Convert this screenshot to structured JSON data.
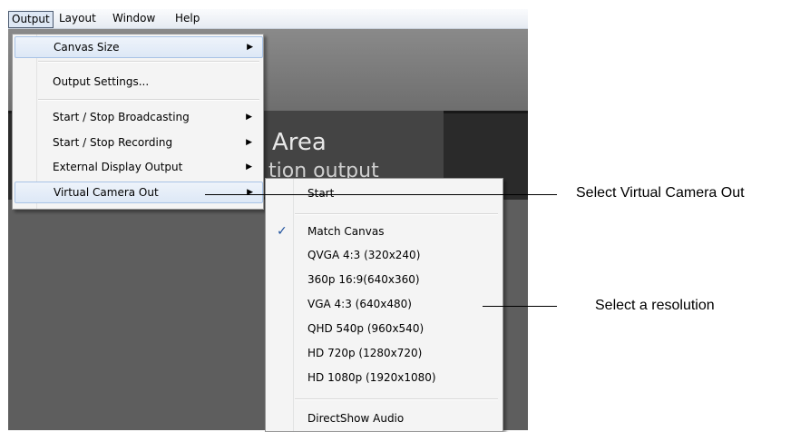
{
  "menubar": {
    "items": [
      "Output",
      "Layout",
      "Window",
      "Help"
    ]
  },
  "preview": {
    "title": "Area",
    "subtitle": "tion output"
  },
  "output_menu": {
    "items": [
      {
        "label": "Canvas Size",
        "submenu": true
      },
      {
        "label": "Output Settings...",
        "submenu": false
      },
      {
        "label": "Start / Stop Broadcasting",
        "submenu": true
      },
      {
        "label": "Start / Stop Recording",
        "submenu": true
      },
      {
        "label": "External Display Output",
        "submenu": true
      },
      {
        "label": "Virtual Camera Out",
        "submenu": true
      }
    ],
    "arrow_glyph": "▶"
  },
  "virtual_camera_menu": {
    "items": [
      {
        "label": "Start",
        "checked": false
      },
      {
        "label": "Match Canvas",
        "checked": true
      },
      {
        "label": "QVGA 4:3 (320x240)",
        "checked": false
      },
      {
        "label": "360p 16:9(640x360)",
        "checked": false
      },
      {
        "label": "VGA 4:3 (640x480)",
        "checked": false
      },
      {
        "label": "QHD 540p (960x540)",
        "checked": false
      },
      {
        "label": "HD 720p (1280x720)",
        "checked": false
      },
      {
        "label": "HD 1080p (1920x1080)",
        "checked": false
      },
      {
        "label": "DirectShow Audio",
        "checked": false
      }
    ],
    "check_glyph": "✓"
  },
  "annotations": {
    "select_virtual_camera": "Select Virtual Camera Out",
    "select_resolution": "Select a resolution"
  }
}
